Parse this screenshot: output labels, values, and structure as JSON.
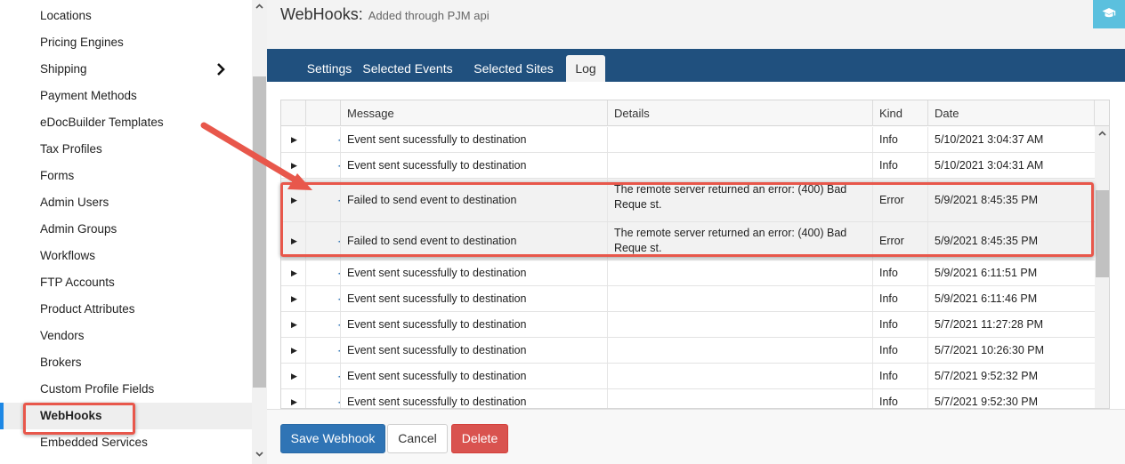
{
  "sidebar": {
    "items": [
      {
        "label": "Locations"
      },
      {
        "label": "Pricing Engines"
      },
      {
        "label": "Shipping",
        "has_submenu": true
      },
      {
        "label": "Payment Methods"
      },
      {
        "label": "eDocBuilder Templates"
      },
      {
        "label": "Tax Profiles"
      },
      {
        "label": "Forms"
      },
      {
        "label": "Admin Users"
      },
      {
        "label": "Admin Groups"
      },
      {
        "label": "Workflows"
      },
      {
        "label": "FTP Accounts"
      },
      {
        "label": "Product Attributes"
      },
      {
        "label": "Vendors"
      },
      {
        "label": "Brokers"
      },
      {
        "label": "Custom Profile Fields"
      },
      {
        "label": "WebHooks",
        "active": true
      },
      {
        "label": "Embedded Services"
      }
    ]
  },
  "header": {
    "title": "WebHooks:",
    "subtitle": "Added through PJM api",
    "help_icon": "graduation-cap-icon"
  },
  "tabs": [
    {
      "label": "Settings"
    },
    {
      "label": "Selected Events"
    },
    {
      "label": "Selected Sites"
    },
    {
      "label": "Log",
      "active": true
    }
  ],
  "grid": {
    "columns": {
      "message": "Message",
      "details": "Details",
      "kind": "Kind",
      "date": "Date"
    },
    "rows": [
      {
        "message": "Event sent sucessfully to destination",
        "details": "",
        "kind": "Info",
        "date": "5/10/2021 3:04:37 AM"
      },
      {
        "message": "Event sent sucessfully to destination",
        "details": "",
        "kind": "Info",
        "date": "5/10/2021 3:04:31 AM"
      },
      {
        "message": "Failed to send event to destination",
        "details": "The remote server returned an error: (400) Bad Reque st.",
        "kind": "Error",
        "date": "5/9/2021 8:45:35 PM"
      },
      {
        "message": "Failed to send event to destination",
        "details": "The remote server returned an error: (400) Bad Reque st.",
        "kind": "Error",
        "date": "5/9/2021 8:45:35 PM"
      },
      {
        "message": "Event sent sucessfully to destination",
        "details": "",
        "kind": "Info",
        "date": "5/9/2021 6:11:51 PM"
      },
      {
        "message": "Event sent sucessfully to destination",
        "details": "",
        "kind": "Info",
        "date": "5/9/2021 6:11:46 PM"
      },
      {
        "message": "Event sent sucessfully to destination",
        "details": "",
        "kind": "Info",
        "date": "5/7/2021 11:27:28 PM"
      },
      {
        "message": "Event sent sucessfully to destination",
        "details": "",
        "kind": "Info",
        "date": "5/7/2021 10:26:30 PM"
      },
      {
        "message": "Event sent sucessfully to destination",
        "details": "",
        "kind": "Info",
        "date": "5/7/2021 9:52:32 PM"
      },
      {
        "message": "Event sent sucessfully to destination",
        "details": "",
        "kind": "Info",
        "date": "5/7/2021 9:52:30 PM"
      }
    ]
  },
  "footer": {
    "save_label": "Save Webhook",
    "cancel_label": "Cancel",
    "delete_label": "Delete"
  },
  "colors": {
    "tab_bar": "#20507e",
    "primary": "#2f74b5",
    "danger": "#d9534f",
    "info": "#5bc0de",
    "annotation": "#e8574b",
    "plane_icon": "#2f74b5"
  }
}
